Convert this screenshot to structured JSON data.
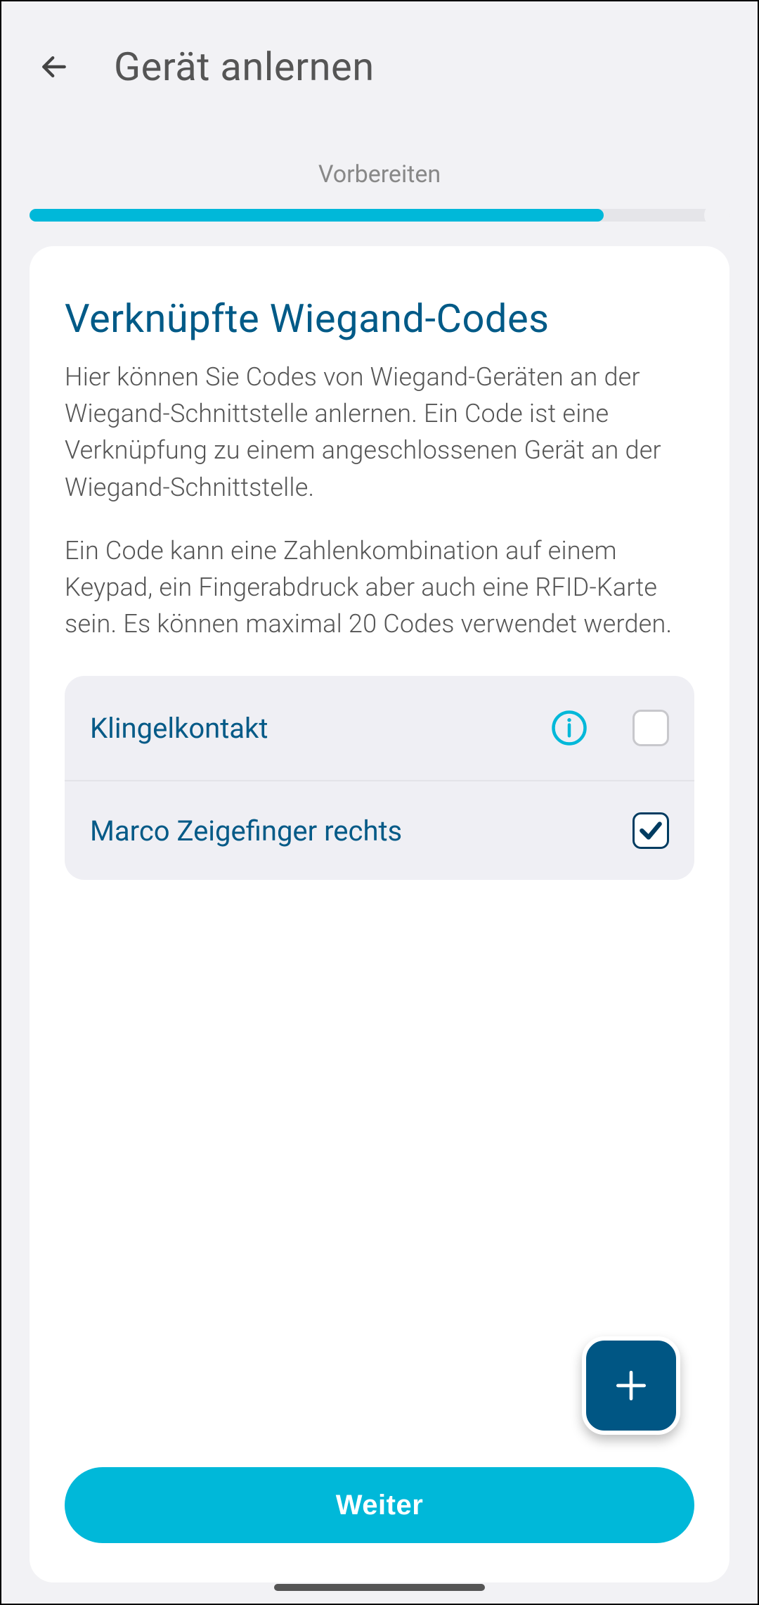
{
  "header": {
    "title": "Gerät anlernen"
  },
  "wizard": {
    "step_label": "Vorbereiten",
    "progress_percent": 82
  },
  "main": {
    "title": "Verknüpfte Wiegand-Codes",
    "paragraph1": "Hier können Sie Codes von Wiegand-Geräten an der Wiegand-Schnittstelle anlernen. Ein Code ist eine Verknüpfung zu einem angeschlossenen Gerät an der Wiegand-Schnittstelle.",
    "paragraph2": "Ein Code kann eine Zahlenkombination auf einem Keypad, ein Fingerabdruck aber auch eine RFID-Karte sein. Es können maximal 20 Codes verwendet werden.",
    "codes": [
      {
        "label": "Klingelkontakt",
        "has_info": true,
        "checked": false
      },
      {
        "label": "Marco Zeigefinger rechts",
        "has_info": false,
        "checked": true
      }
    ],
    "next_label": "Weiter"
  },
  "colors": {
    "accent": "#00b8d9",
    "primary_dark": "#005684",
    "heading": "#005a87"
  }
}
